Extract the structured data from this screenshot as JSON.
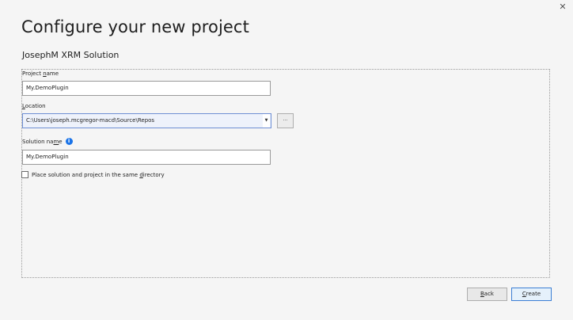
{
  "dialog": {
    "close_glyph": "✕",
    "title": "Configure your new project",
    "template_name": "JosephM XRM Solution"
  },
  "fields": {
    "project_name": {
      "label_pre": "Project ",
      "label_key": "n",
      "label_post": "ame",
      "value": "My.DemoPlugin"
    },
    "location": {
      "label_pre": "",
      "label_key": "L",
      "label_post": "ocation",
      "value": "C:\\Users\\joseph.mcgregor-macd\\Source\\Repos",
      "dropdown_glyph": "▼"
    },
    "browse_label": "...",
    "solution_name": {
      "label_pre": "Solution na",
      "label_key": "m",
      "label_post": "e",
      "info_glyph": "i",
      "value": "My.DemoPlugin"
    },
    "same_directory": {
      "label_pre": "Place solution and project in the same ",
      "label_key": "d",
      "label_post": "irectory",
      "checked": false
    }
  },
  "buttons": {
    "back_key": "B",
    "back_rest": "ack",
    "create_key": "C",
    "create_rest": "reate"
  }
}
